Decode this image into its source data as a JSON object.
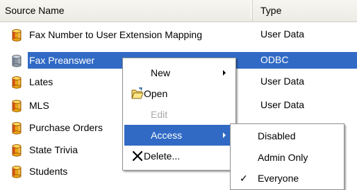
{
  "columns": {
    "name": "Source Name",
    "type": "Type"
  },
  "rows": [
    {
      "name": "Fax Number to User Extension Mapping",
      "type": "User Data",
      "icon": "database-icon"
    },
    {
      "name": "Fax Preanswer",
      "type": "ODBC",
      "icon": "database-icon",
      "selected": true
    },
    {
      "name": "Lates",
      "type": "User Data",
      "icon": "database-icon"
    },
    {
      "name": "MLS",
      "type": "User Data",
      "icon": "database-icon"
    },
    {
      "name": "Purchase Orders",
      "type": "",
      "icon": "database-icon"
    },
    {
      "name": "State Trivia",
      "type": "",
      "icon": "database-icon"
    },
    {
      "name": "Students",
      "type": "",
      "icon": "database-icon"
    }
  ],
  "context_menu": {
    "new": "New",
    "open": "Open",
    "edit": "Edit",
    "access": "Access",
    "delete": "Delete..."
  },
  "access_submenu": {
    "disabled": "Disabled",
    "admin_only": "Admin Only",
    "everyone": "Everyone",
    "checked_mark": "✓"
  },
  "colors": {
    "selection": "#316ac5",
    "header": "#ecebe4",
    "disabled_text": "#a8a8a8"
  }
}
